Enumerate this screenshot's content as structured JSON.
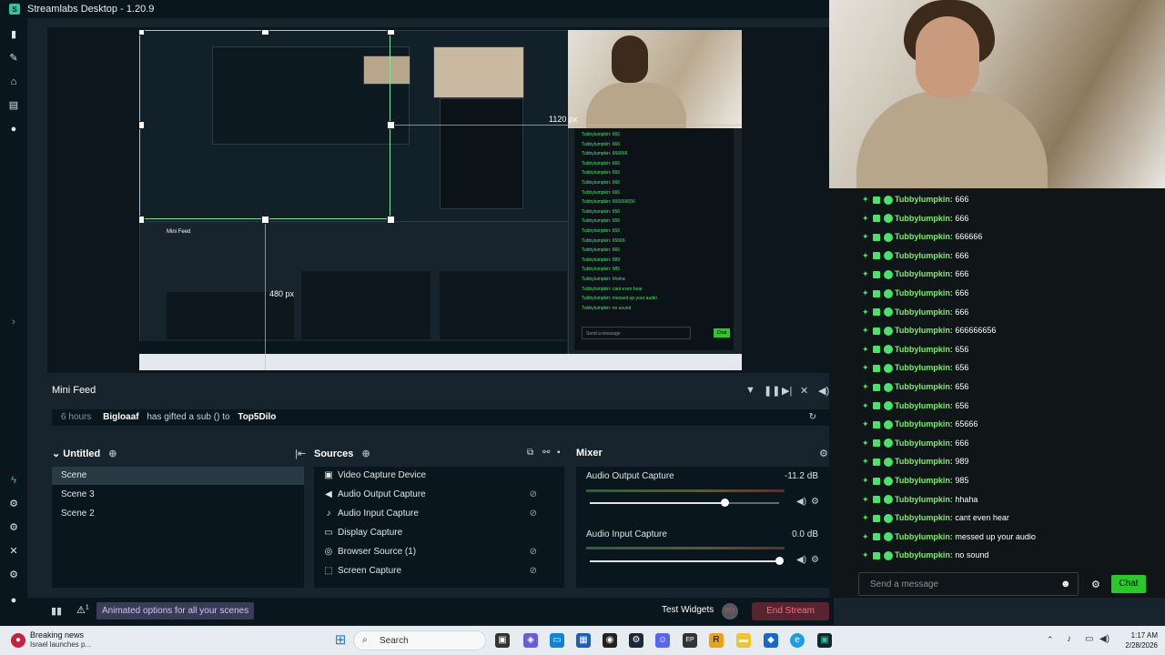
{
  "app": {
    "title": "Streamlabs Desktop - 1.20.9"
  },
  "preview": {
    "measure_top": "1120 px",
    "measure_left": "480 px",
    "mini_lines": [
      "Tubbylumpkin: 666",
      "Tubbylumpkin: 666",
      "Tubbylumpkin: 666666",
      "Tubbylumpkin: 666",
      "Tubbylumpkin: 666",
      "Tubbylumpkin: 666",
      "Tubbylumpkin: 666",
      "Tubbylumpkin: 666666656",
      "Tubbylumpkin: 656",
      "Tubbylumpkin: 656",
      "Tubbylumpkin: 656",
      "Tubbylumpkin: 65666",
      "Tubbylumpkin: 666",
      "Tubbylumpkin: 989",
      "Tubbylumpkin: 985",
      "Tubbylumpkin: hhaha",
      "Tubbylumpkin: cant even hear",
      "Tubbylumpkin: messed up your audio",
      "Tubbylumpkin: no sound"
    ],
    "mini_send": "Send a message",
    "mini_chat": "Chat"
  },
  "minifeed": {
    "title": "Mini Feed",
    "event": {
      "time": "6 hours",
      "user": "Bigloaaf",
      "action": "has gifted a sub () to",
      "target": "Top5Dilo"
    }
  },
  "scenes": {
    "title": "Untitled",
    "items": [
      "Scene",
      "Scene 3",
      "Scene 2"
    ]
  },
  "sources": {
    "title": "Sources",
    "items": [
      {
        "label": "Video Capture Device",
        "icon": "camera-icon"
      },
      {
        "label": "Audio Output Capture",
        "icon": "speaker-icon"
      },
      {
        "label": "Audio Input Capture",
        "icon": "microphone-icon"
      },
      {
        "label": "Display Capture",
        "icon": "monitor-icon"
      },
      {
        "label": "Browser Source (1)",
        "icon": "globe-icon"
      },
      {
        "label": "Screen Capture",
        "icon": "screen-region-icon"
      }
    ]
  },
  "mixer": {
    "title": "Mixer",
    "channels": [
      {
        "label": "Audio Output Capture",
        "db": "-11.2 dB",
        "level": 0.71
      },
      {
        "label": "Audio Input Capture",
        "db": "0.0 dB",
        "level": 1.0
      }
    ]
  },
  "footer": {
    "promo": "Animated options for all your scenes",
    "test_widgets": "Test Widgets",
    "end_stream": "End Stream",
    "alert_count": "1"
  },
  "chat": {
    "messages": [
      {
        "user": "Tubbylumpkin:",
        "text": " 666"
      },
      {
        "user": "Tubbylumpkin:",
        "text": " 666"
      },
      {
        "user": "Tubbylumpkin:",
        "text": " 666666"
      },
      {
        "user": "Tubbylumpkin:",
        "text": " 666"
      },
      {
        "user": "Tubbylumpkin:",
        "text": " 666"
      },
      {
        "user": "Tubbylumpkin:",
        "text": " 666"
      },
      {
        "user": "Tubbylumpkin:",
        "text": " 666"
      },
      {
        "user": "Tubbylumpkin:",
        "text": " 666666656"
      },
      {
        "user": "Tubbylumpkin:",
        "text": " 656"
      },
      {
        "user": "Tubbylumpkin:",
        "text": " 656"
      },
      {
        "user": "Tubbylumpkin:",
        "text": " 656"
      },
      {
        "user": "Tubbylumpkin:",
        "text": " 656"
      },
      {
        "user": "Tubbylumpkin:",
        "text": " 65666"
      },
      {
        "user": "Tubbylumpkin:",
        "text": " 666"
      },
      {
        "user": "Tubbylumpkin:",
        "text": " 989"
      },
      {
        "user": "Tubbylumpkin:",
        "text": " 985"
      },
      {
        "user": "Tubbylumpkin:",
        "text": " hhaha"
      },
      {
        "user": "Tubbylumpkin:",
        "text": " cant even hear"
      },
      {
        "user": "Tubbylumpkin:",
        "text": " messed up your audio"
      },
      {
        "user": "Tubbylumpkin:",
        "text": " no sound"
      }
    ],
    "input_placeholder": "Send a message",
    "send_label": "Chat"
  },
  "taskbar": {
    "news_title": "Breaking news",
    "news_sub": "Israel launches p...",
    "search": "Search",
    "time": "1:17 AM",
    "date": "2/28/2026"
  },
  "colors": {
    "accent": "#31c3a2",
    "chat_green": "#47e36b",
    "end_stream": "#582430"
  }
}
